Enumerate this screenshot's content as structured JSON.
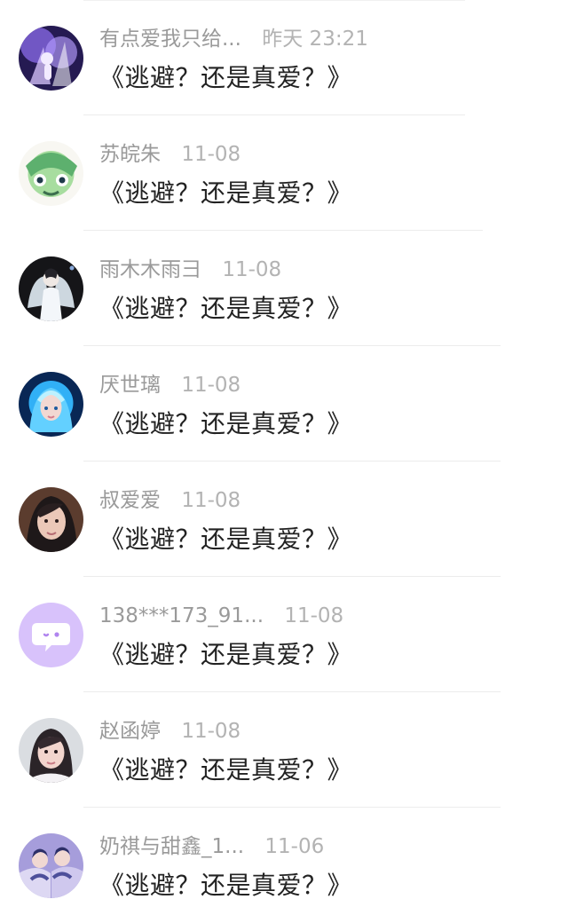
{
  "comments": [
    {
      "user": "有点爱我只给...",
      "time": "昨天 23:21",
      "text": "《逃避？还是真爱？》",
      "avatar_icon": "purple-concert-avatar-icon",
      "avatar_colors": [
        "#2b1f5c",
        "#8a6ad8",
        "#d9c7ff"
      ]
    },
    {
      "user": "苏皖朱",
      "time": "11-08",
      "text": "《逃避？还是真爱？》",
      "avatar_icon": "green-anime-avatar-icon",
      "avatar_colors": [
        "#f7f7f2",
        "#9ed79d",
        "#4a9b64"
      ]
    },
    {
      "user": "雨木木雨彐",
      "time": "11-08",
      "text": "《逃避？还是真爱？》",
      "avatar_icon": "winged-person-avatar-icon",
      "avatar_colors": [
        "#17171b",
        "#e7eef5",
        "#9ab4d8"
      ]
    },
    {
      "user": "厌世璃",
      "time": "11-08",
      "text": "《逃避？还是真爱？》",
      "avatar_icon": "blue-haired-character-avatar-icon",
      "avatar_colors": [
        "#0a2a5c",
        "#38b9ff",
        "#e6f8ff"
      ]
    },
    {
      "user": "叔爱爱",
      "time": "11-08",
      "text": "《逃避？还是真爱？》",
      "avatar_icon": "portrait-avatar-icon",
      "avatar_colors": [
        "#5c3b2b",
        "#e8c7b7",
        "#1e1a1a"
      ]
    },
    {
      "user": "138***173_91...",
      "time": "11-08",
      "text": "《逃避？还是真爱？》",
      "avatar_icon": "chat-bubble-avatar-icon",
      "avatar_colors": [
        "#d9c4fb",
        "#ffffff",
        "#b488ef"
      ]
    },
    {
      "user": "赵函婷",
      "time": "11-08",
      "text": "《逃避？还是真爱？》",
      "avatar_icon": "girl-portrait-avatar-icon",
      "avatar_colors": [
        "#d8dadd",
        "#f3d7cf",
        "#2a2227"
      ]
    },
    {
      "user": "奶祺与甜鑫_1...",
      "time": "11-06",
      "text": "《逃避？还是真爱？》",
      "avatar_icon": "couple-avatar-icon",
      "avatar_colors": [
        "#9b90d4",
        "#dfdbf4",
        "#2d2f68"
      ]
    }
  ]
}
